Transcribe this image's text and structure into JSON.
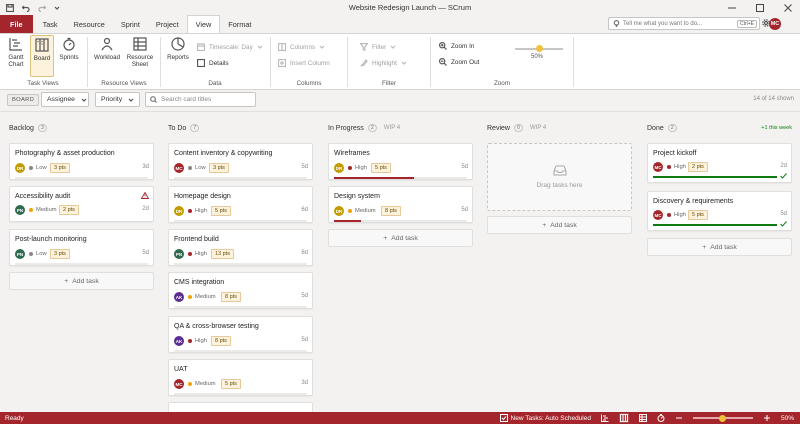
{
  "window": {
    "title": "Website Redesign Launch — SCrum"
  },
  "search": {
    "placeholder": "Tell me what you want to do...",
    "shortcut": "Ctrl+E"
  },
  "user": {
    "initials": "MC"
  },
  "menu": {
    "file": "File",
    "tabs": [
      "Task",
      "Resource",
      "Sprint",
      "Project",
      "View",
      "Format"
    ],
    "active": "View"
  },
  "ribbon": {
    "task_views": {
      "label": "Task Views",
      "gantt": "Gantt\nChart",
      "board": "Board",
      "sprints": "Sprints"
    },
    "resource_views": {
      "label": "Resource Views",
      "workload": "Workload",
      "sheet": "Resource\nSheet"
    },
    "data": {
      "label": "Data",
      "reports": "Reports",
      "timescale": "Timescale: Day",
      "details": "Details"
    },
    "columns": {
      "label": "Columns",
      "columns": "Columns",
      "insert": "Insert Column"
    },
    "filter": {
      "label": "Filter",
      "filter": "Filter",
      "highlight": "Highlight"
    },
    "zoom": {
      "label": "Zoom",
      "zoom_in": "Zoom In",
      "zoom_out": "Zoom Out",
      "percent": "50%",
      "level": 0.5
    }
  },
  "toolbar": {
    "mode": "BOARD",
    "group_by": "Assignee",
    "sort_by": "Priority",
    "filter_placeholder": "Search card titles",
    "shown": "14 of 14 shown"
  },
  "colors": {
    "accent": "#a4262c",
    "high": "#a4262c",
    "medium": "#f0a30a",
    "low": "#8a8886",
    "done": "#107c10"
  },
  "columns": [
    {
      "name": "Backlog",
      "count": "3",
      "wip": "",
      "note": "",
      "add": "Add task",
      "cards": [
        {
          "title": "Photography & asset production",
          "assignee": "DR",
          "avatar_color": "#c19c00",
          "priority": "Low",
          "points": "3 pts",
          "days": "3d",
          "flag": false
        },
        {
          "title": "Accessibility audit",
          "assignee": "PN",
          "avatar_color": "#2f6b4f",
          "priority": "Medium",
          "points": "2 pts",
          "days": "2d",
          "flag": true
        },
        {
          "title": "Post-launch monitoring",
          "assignee": "PN",
          "avatar_color": "#2f6b4f",
          "priority": "Low",
          "points": "3 pts",
          "days": "5d",
          "flag": false
        }
      ]
    },
    {
      "name": "To Do",
      "count": "7",
      "wip": "",
      "note": "",
      "add": "",
      "cards": [
        {
          "title": "Content inventory & copywriting",
          "assignee": "MC",
          "avatar_color": "#a4262c",
          "priority": "Low",
          "points": "3 pts",
          "days": "5d"
        },
        {
          "title": "Homepage design",
          "assignee": "DR",
          "avatar_color": "#c19c00",
          "priority": "High",
          "points": "5 pts",
          "days": "6d"
        },
        {
          "title": "Frontend build",
          "assignee": "PN",
          "avatar_color": "#2f6b4f",
          "priority": "High",
          "points": "13 pts",
          "days": "8d"
        },
        {
          "title": "CMS integration",
          "assignee": "AK",
          "avatar_color": "#5c2e91",
          "priority": "Medium",
          "points": "8 pts",
          "days": "5d"
        },
        {
          "title": "QA & cross-browser testing",
          "assignee": "AK",
          "avatar_color": "#5c2e91",
          "priority": "High",
          "points": "8 pts",
          "days": "5d"
        },
        {
          "title": "UAT",
          "assignee": "MC",
          "avatar_color": "#a4262c",
          "priority": "Medium",
          "points": "5 pts",
          "days": "3d"
        }
      ]
    },
    {
      "name": "In Progress",
      "count": "2",
      "wip": "WIP 4",
      "note": "",
      "add": "Add task",
      "cards": [
        {
          "title": "Wireframes",
          "assignee": "DR",
          "avatar_color": "#c19c00",
          "priority": "High",
          "points": "5 pts",
          "days": "5d",
          "progress": 0.6
        },
        {
          "title": "Design system",
          "assignee": "DR",
          "avatar_color": "#c19c00",
          "priority": "Medium",
          "points": "8 pts",
          "days": "5d",
          "progress": 0.2
        }
      ]
    },
    {
      "name": "Review",
      "count": "0",
      "wip": "WIP 4",
      "note": "",
      "add": "Add task",
      "empty": "Drag tasks here",
      "cards": []
    },
    {
      "name": "Done",
      "count": "2",
      "wip": "",
      "note": "+1 this week",
      "add": "Add task",
      "cards": [
        {
          "title": "Project kickoff",
          "assignee": "MC",
          "avatar_color": "#a4262c",
          "priority": "High",
          "points": "2 pts",
          "days": "2d",
          "progress": 1
        },
        {
          "title": "Discovery & requirements",
          "assignee": "MC",
          "avatar_color": "#a4262c",
          "priority": "High",
          "points": "5 pts",
          "days": "5d",
          "progress": 1
        }
      ]
    }
  ],
  "status": {
    "ready": "Ready",
    "new_tasks": "New Tasks: Auto Scheduled",
    "zoom": "50%"
  }
}
